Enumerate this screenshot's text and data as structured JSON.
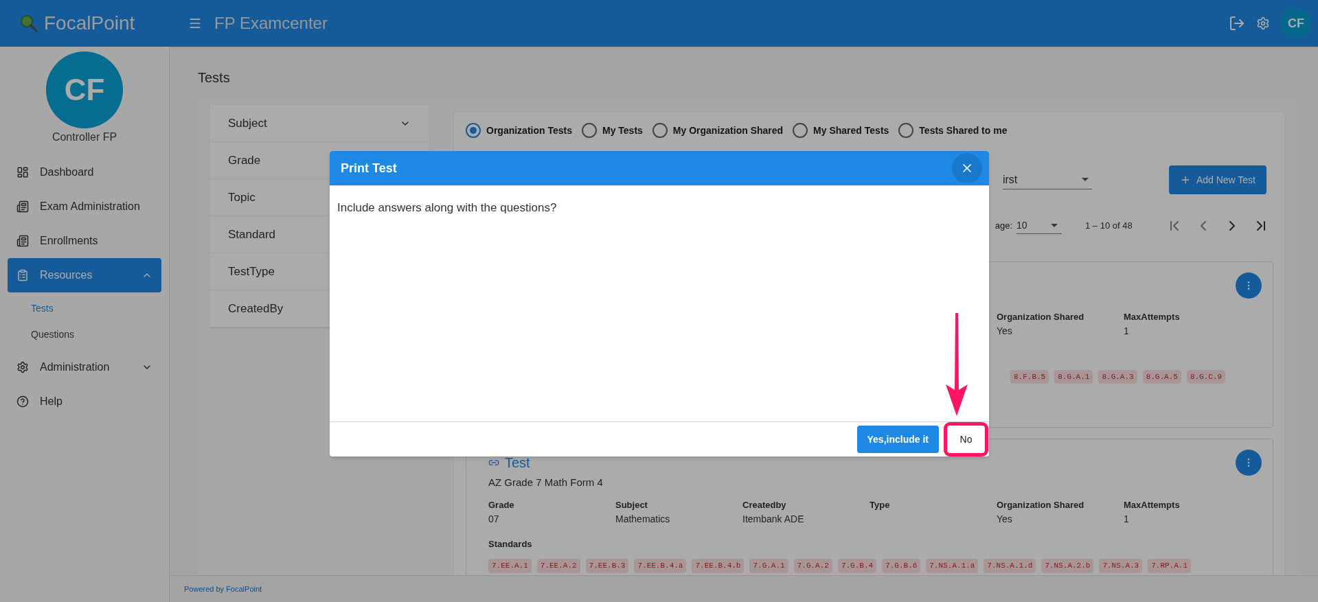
{
  "header": {
    "brand": "FocalPoint",
    "title": "FP Examcenter",
    "avatar": "CF"
  },
  "sidebar": {
    "avatar": "CF",
    "user": "Controller FP",
    "items": [
      {
        "kind": "dashboard",
        "label": "Dashboard",
        "selected": false
      },
      {
        "kind": "book",
        "label": "Exam Administration",
        "selected": false
      },
      {
        "kind": "book",
        "label": "Enrollments",
        "selected": false
      },
      {
        "kind": "clipboard",
        "label": "Resources",
        "selected": true,
        "expanded": true,
        "children": [
          {
            "label": "Tests",
            "selected": true
          },
          {
            "label": "Questions",
            "selected": false
          }
        ]
      },
      {
        "kind": "gear",
        "label": "Administration",
        "selected": false,
        "expanded": false
      },
      {
        "kind": "help",
        "label": "Help",
        "selected": false
      }
    ]
  },
  "page": {
    "title": "Tests"
  },
  "filters": [
    {
      "label": "Subject",
      "expanded": false
    },
    {
      "label": "Grade"
    },
    {
      "label": "Topic"
    },
    {
      "label": "Standard"
    },
    {
      "label": "TestType"
    },
    {
      "label": "CreatedBy"
    }
  ],
  "test_scope": [
    {
      "label": "Organization Tests",
      "selected": true
    },
    {
      "label": "My Tests",
      "selected": false
    },
    {
      "label": "My Organization Shared",
      "selected": false
    },
    {
      "label": "My Shared Tests",
      "selected": false
    },
    {
      "label": "Tests Shared to me",
      "selected": false
    }
  ],
  "sort_field": {
    "value": "irst"
  },
  "add_button": "Add New Test",
  "pagination": {
    "label": "age:",
    "page_size": "10",
    "range": "1 – 10 of 48"
  },
  "cards": [
    {
      "fields": [
        {
          "label": "Organization Shared",
          "value": "Yes"
        },
        {
          "label": "MaxAttempts",
          "value": "1"
        }
      ],
      "standards": [
        "8.F.B.5",
        "8.G.A.1",
        "8.G.A.3",
        "8.G.A.5",
        "8.G.C.9"
      ]
    },
    {
      "title": "Test",
      "name": "AZ Grade 7 Math Form 4",
      "fields": [
        {
          "label": "Grade",
          "value": "07"
        },
        {
          "label": "Subject",
          "value": "Mathematics"
        },
        {
          "label": "Createdby",
          "value": "Itembank ADE"
        },
        {
          "label": "Type"
        },
        {
          "label": "Organization Shared",
          "value": "Yes"
        },
        {
          "label": "MaxAttempts",
          "value": "1"
        }
      ],
      "standards_label": "Standards",
      "standards": [
        "7.EE.A.1",
        "7.EE.A.2",
        "7.EE.B.3",
        "7.EE.B.4.a",
        "7.EE.B.4.b",
        "7.G.A.1",
        "7.G.A.2",
        "7.G.B.4",
        "7.G.B.6",
        "7.NS.A.1.a",
        "7.NS.A.1.d",
        "7.NS.A.2.b",
        "7.NS.A.3",
        "7.RP.A.1"
      ]
    }
  ],
  "footer": "Powered by FocalPoint",
  "dialog": {
    "title": "Print Test",
    "message": "Include answers along with the questions?",
    "buttons": [
      {
        "label": "Yes,include it",
        "kind": "primary",
        "highlighted": false
      },
      {
        "label": "No",
        "kind": "plain",
        "highlighted": true
      }
    ]
  },
  "annotation": {
    "kind": "arrow"
  }
}
